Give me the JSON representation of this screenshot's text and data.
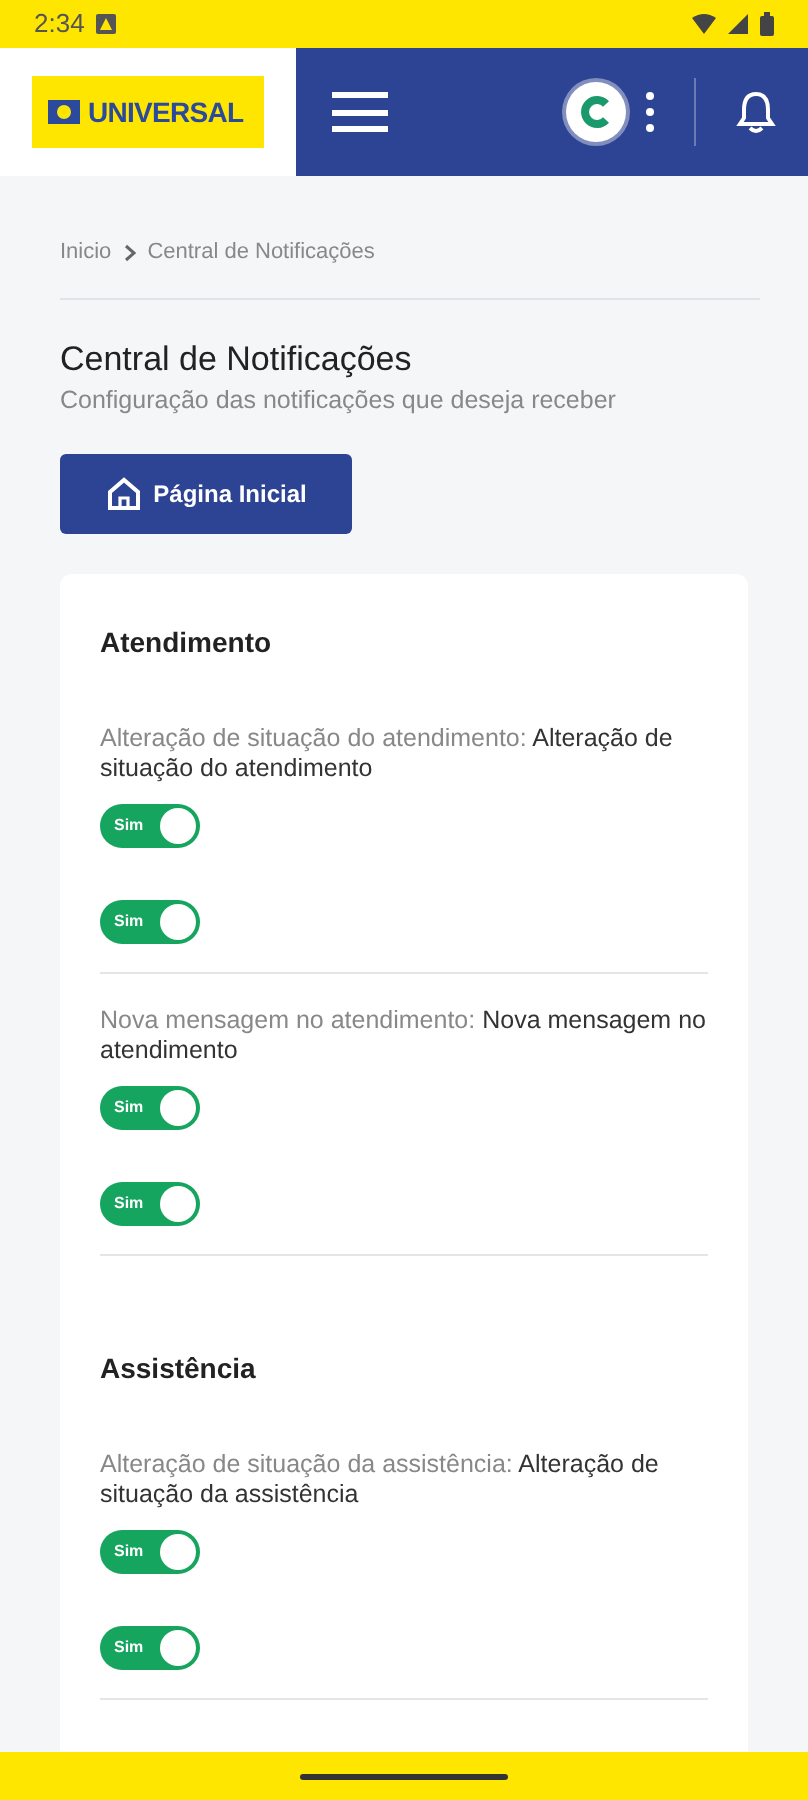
{
  "status_bar": {
    "time": "2:34"
  },
  "header": {
    "logo": "UNIVERSAL"
  },
  "breadcrumb": [
    "Inicio",
    "Central de Notificações"
  ],
  "page": {
    "title": "Central de Notificações",
    "subtitle": "Configuração das notificações que deseja receber"
  },
  "home_button": "Página Inicial",
  "sections": [
    {
      "title": "Atendimento",
      "items": [
        {
          "label": "Alteração de situação do atendimento:",
          "description": "Alteração de situação do atendimento",
          "toggles": [
            {
              "label": "Sim",
              "on": true
            },
            {
              "label": "Sim",
              "on": true
            }
          ]
        },
        {
          "label": "Nova mensagem no atendimento:",
          "description": "Nova mensagem no atendimento",
          "toggles": [
            {
              "label": "Sim",
              "on": true
            },
            {
              "label": "Sim",
              "on": true
            }
          ]
        }
      ]
    },
    {
      "title": "Assistência",
      "items": [
        {
          "label": "Alteração de situação da assistência:",
          "description": "Alteração de situação da assistência",
          "toggles": [
            {
              "label": "Sim",
              "on": true
            },
            {
              "label": "Sim",
              "on": true
            }
          ]
        }
      ]
    }
  ]
}
